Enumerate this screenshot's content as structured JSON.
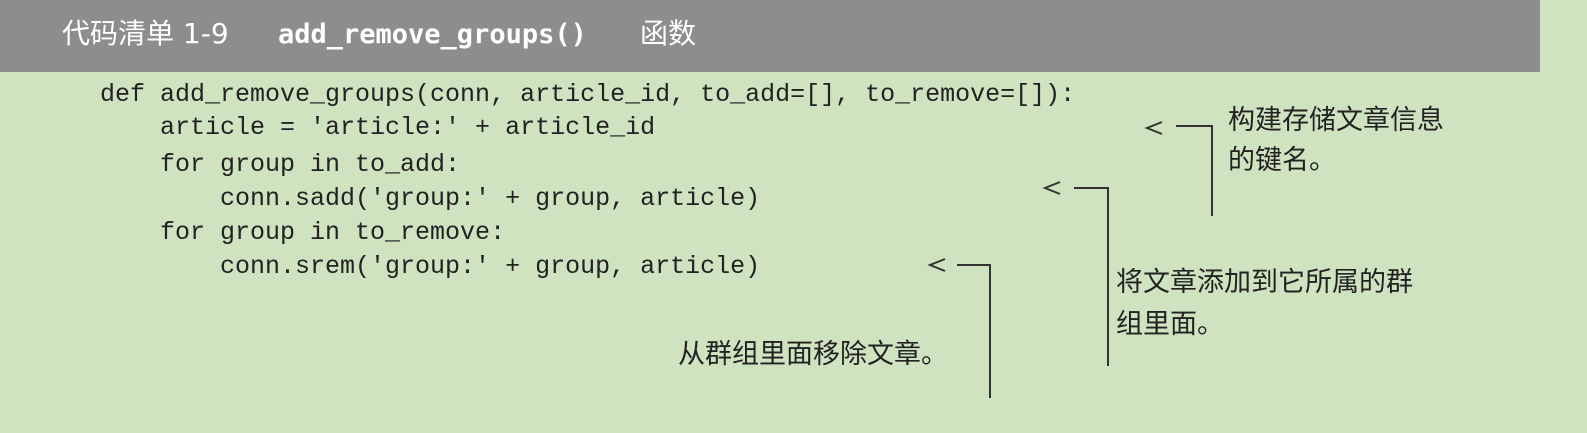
{
  "listing": {
    "number": "代码清单 1-9",
    "function_name": "add_remove_groups()",
    "suffix": "函数"
  },
  "code": [
    "def add_remove_groups(conn, article_id, to_add=[], to_remove=[]):",
    "    article = 'article:' + article_id",
    "    for group in to_add:",
    "        conn.sadd('group:' + group, article)",
    "    for group in to_remove:",
    "        conn.srem('group:' + group, article)"
  ],
  "annotations": {
    "key_name": {
      "line1": "构建存储文章信息",
      "line2": "的键名。"
    },
    "add_to_group": {
      "line1": "将文章添加到它所属的群",
      "line2": "组里面。"
    },
    "remove_from_group": {
      "line1": "从群组里面移除文章。"
    }
  }
}
